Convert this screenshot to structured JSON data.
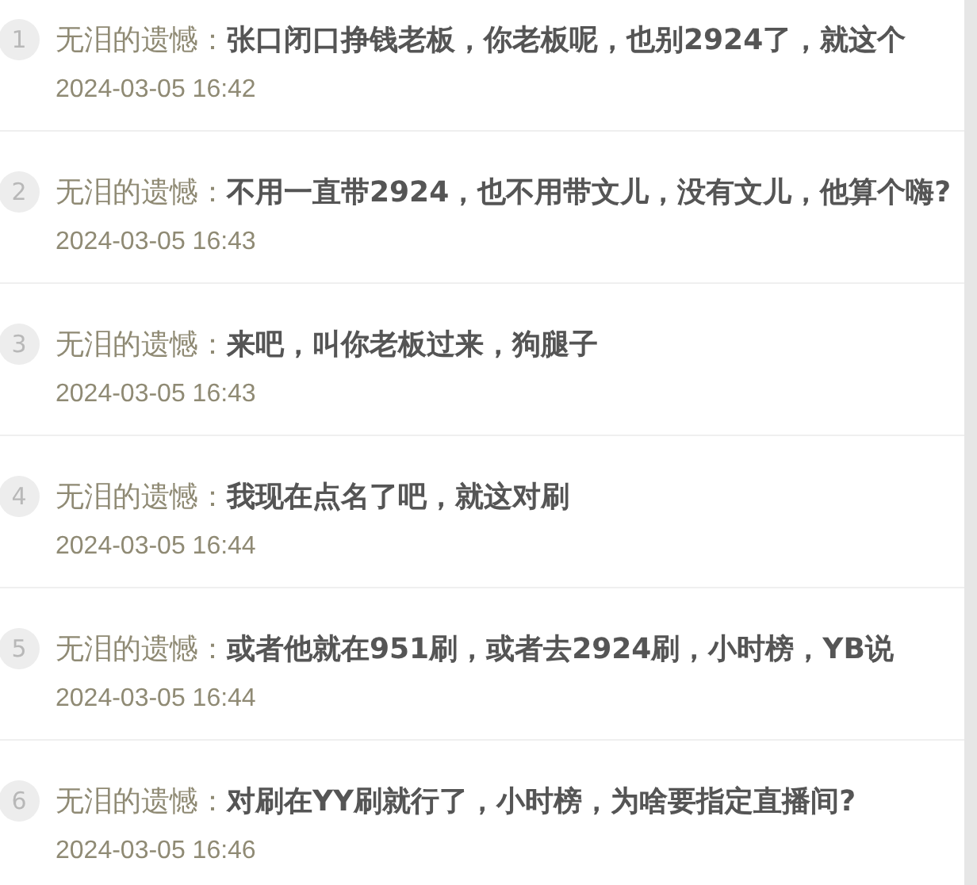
{
  "comments": [
    {
      "number": "1",
      "author": "无泪的遗憾：",
      "text": "张口闭口挣钱老板，你老板呢，也别2924了，就这个",
      "time": "2024-03-05 16:42"
    },
    {
      "number": "2",
      "author": "无泪的遗憾：",
      "text": "不用一直带2924，也不用带文儿，没有文儿，他算个嗨?",
      "time": "2024-03-05 16:43"
    },
    {
      "number": "3",
      "author": "无泪的遗憾：",
      "text": "来吧，叫你老板过来，狗腿子",
      "time": "2024-03-05 16:43"
    },
    {
      "number": "4",
      "author": "无泪的遗憾：",
      "text": "我现在点名了吧，就这对刷",
      "time": "2024-03-05 16:44"
    },
    {
      "number": "5",
      "author": "无泪的遗憾：",
      "text": "或者他就在951刷，或者去2924刷，小时榜，YB说",
      "time": "2024-03-05 16:44"
    },
    {
      "number": "6",
      "author": "无泪的遗憾：",
      "text": "对刷在YY刷就行了，小时榜，为啥要指定直播间?",
      "time": "2024-03-05 16:46"
    }
  ]
}
